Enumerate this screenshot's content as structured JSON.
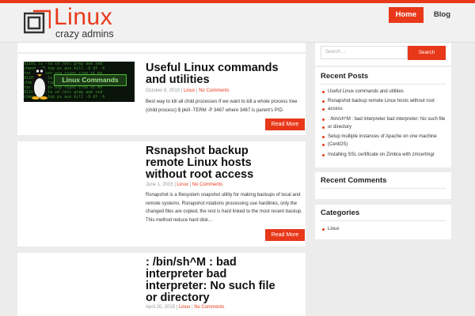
{
  "header": {
    "logo_title": "Linux",
    "logo_subtitle": "crazy admins",
    "nav": [
      {
        "label": "Home"
      },
      {
        "label": "Blog"
      }
    ]
  },
  "posts": [
    {
      "thumbnail_text": "Linux Commands",
      "title_lines": [
        "Useful Linux commands",
        "and utilities"
      ],
      "date": "October 8, 2015",
      "category": "Linux",
      "comments": "No Comments",
      "excerpt_lines": [
        "Best way to kill all child processes If we want to kill a whole process tree",
        "(child process) $ pkill -TERM -P 3467 where 3467 is parent's PID."
      ],
      "read_more": "Read More"
    },
    {
      "title_lines": [
        "Rsnapshot backup",
        "remote Linux hosts",
        "without root access"
      ],
      "date": "June 1, 2015",
      "category": "Linux",
      "comments": "No Comments",
      "excerpt_lines": [
        "Rsnapshot is a filesystem snapshot utility for making backups of local and",
        "remote systems. Rsnapshot rotations processing use hardlinks, only the",
        "changed files are copied, the rest is hard linked to the most recent backup.",
        "This method reduce hard disk…"
      ],
      "read_more": "Read More"
    },
    {
      "title_lines": [
        ": /bin/sh^M : bad",
        "interpreter bad",
        "interpreter: No such file",
        "or directory"
      ],
      "date": "April 20, 2015",
      "category": "Linux",
      "comments": "No Comments"
    }
  ],
  "sidebar": {
    "search_placeholder": "Search ...",
    "search_button": "Search",
    "recent_posts_title": "Recent Posts",
    "recent_posts": [
      "Useful Linux commands and utilities",
      "Rsnapshot backup remote Linux hosts without root",
      "access",
      ": /bin/sh^M : bad interpreter bad interpreter: No such file",
      "or directory",
      "Setup multiple instances of Apache on one machine",
      "(CentOS)",
      "Installing SSL certificate on Zimbra with zmcertmgr"
    ],
    "recent_comments_title": "Recent Comments",
    "categories_title": "Categories",
    "categories": [
      "Linux"
    ]
  },
  "colors": {
    "accent": "#e8381a",
    "background": "#ececec"
  }
}
